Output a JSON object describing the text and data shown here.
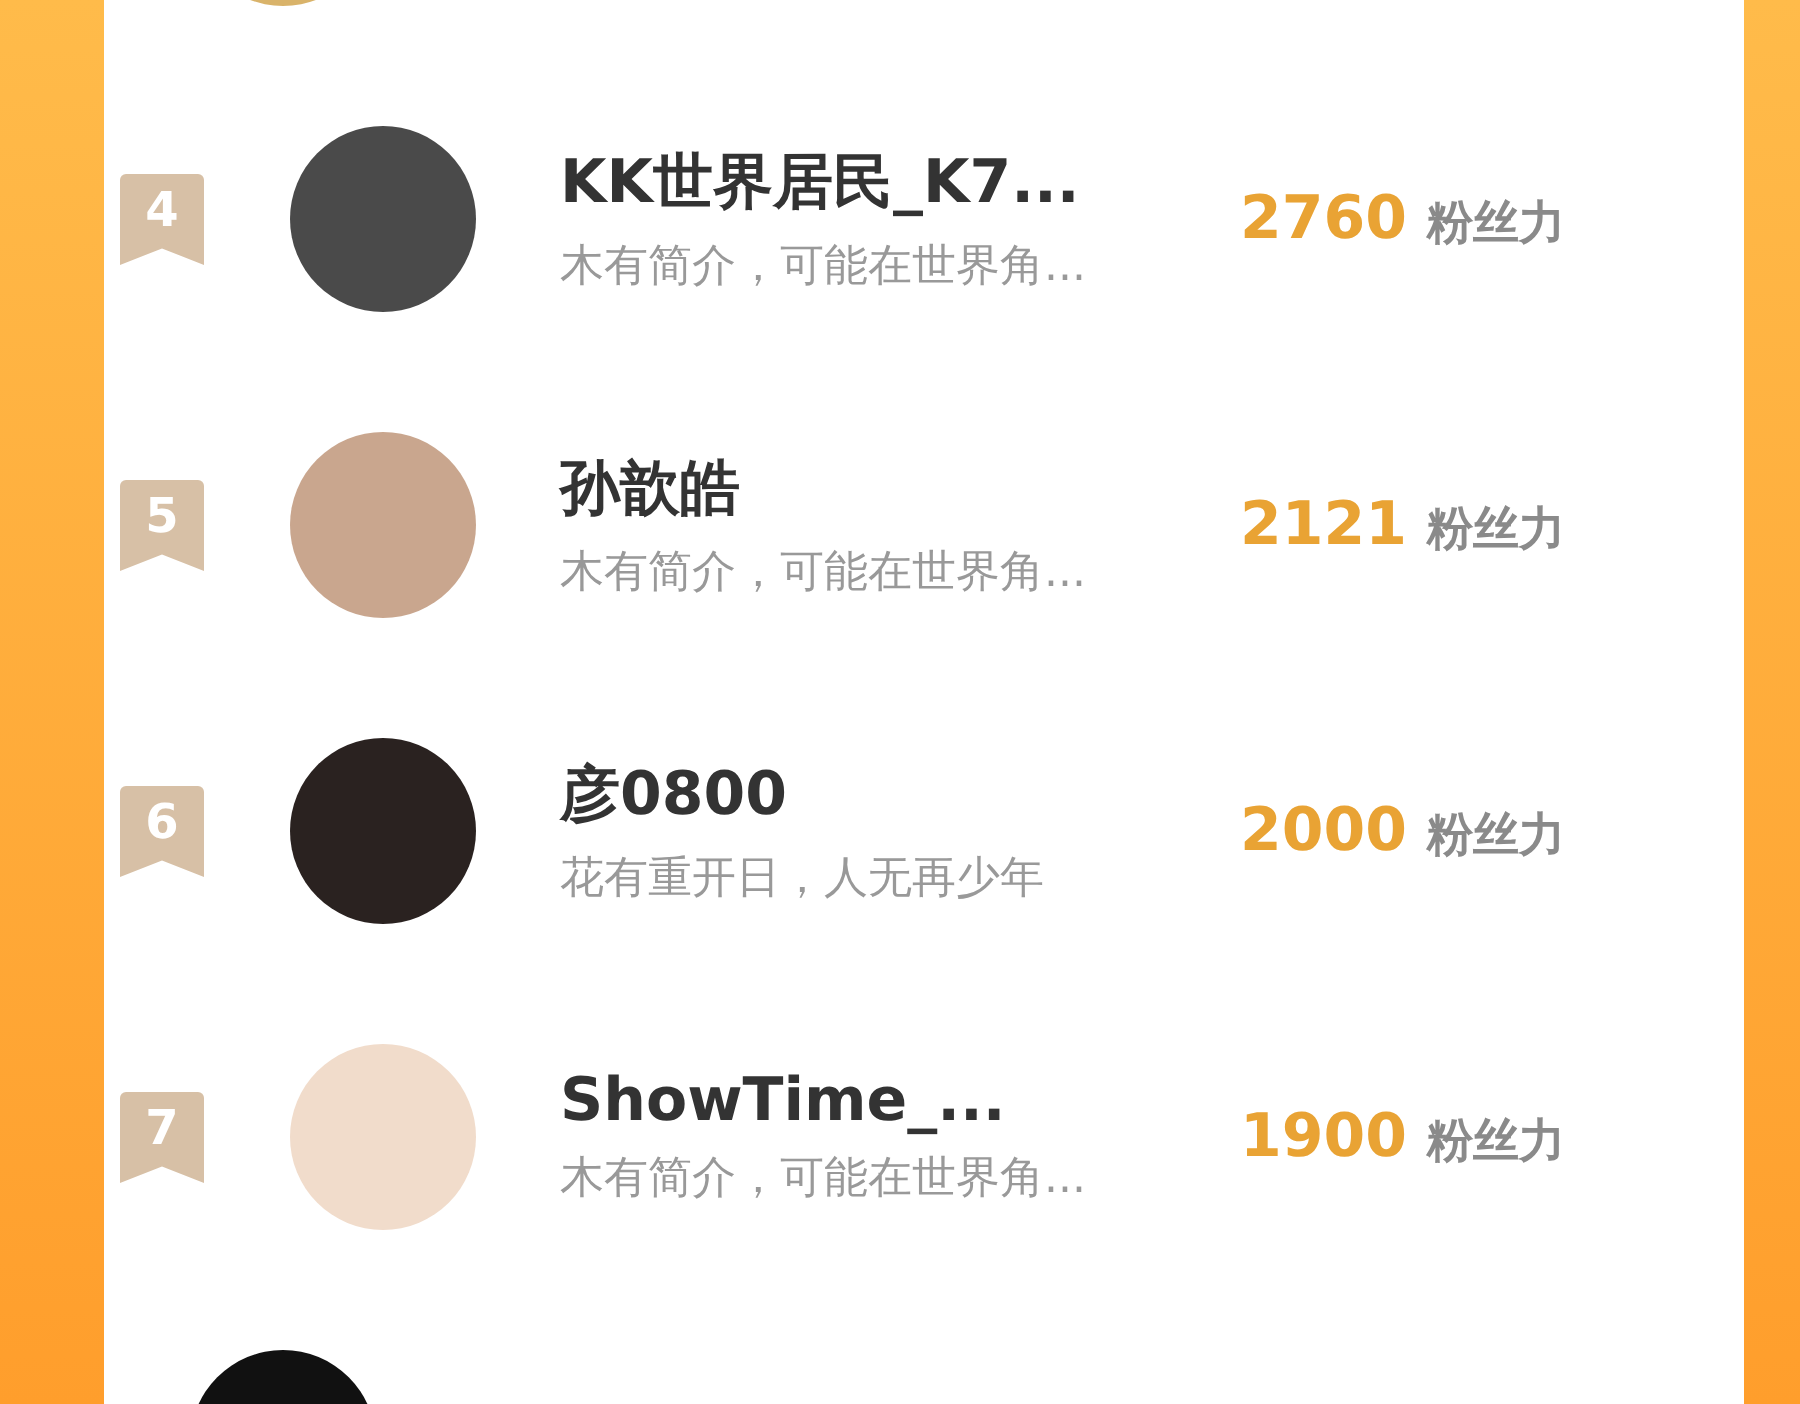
{
  "leaderboard": [
    {
      "rank": "4",
      "name": "KK世界居民_K7...",
      "bio": "木有简介，可能在世界角...",
      "score": "2760",
      "score_unit": "粉丝力"
    },
    {
      "rank": "5",
      "name": "孙歆皓",
      "bio": "木有简介，可能在世界角...",
      "score": "2121",
      "score_unit": "粉丝力"
    },
    {
      "rank": "6",
      "name": "彦0800",
      "bio": "花有重开日，人无再少年",
      "score": "2000",
      "score_unit": "粉丝力"
    },
    {
      "rank": "7",
      "name": "ShowTime_...",
      "bio": "木有简介，可能在世界角...",
      "score": "1900",
      "score_unit": "粉丝力"
    }
  ]
}
